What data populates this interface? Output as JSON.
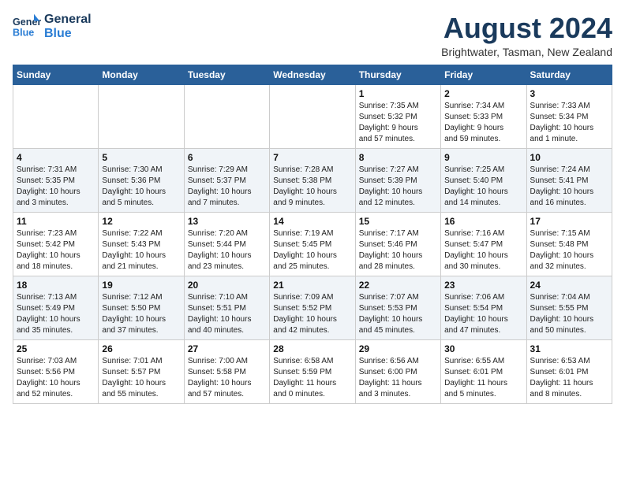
{
  "header": {
    "logo_line1": "General",
    "logo_line2": "Blue",
    "month_year": "August 2024",
    "location": "Brightwater, Tasman, New Zealand"
  },
  "days_of_week": [
    "Sunday",
    "Monday",
    "Tuesday",
    "Wednesday",
    "Thursday",
    "Friday",
    "Saturday"
  ],
  "weeks": [
    [
      {
        "day": "",
        "info": ""
      },
      {
        "day": "",
        "info": ""
      },
      {
        "day": "",
        "info": ""
      },
      {
        "day": "",
        "info": ""
      },
      {
        "day": "1",
        "info": "Sunrise: 7:35 AM\nSunset: 5:32 PM\nDaylight: 9 hours\nand 57 minutes."
      },
      {
        "day": "2",
        "info": "Sunrise: 7:34 AM\nSunset: 5:33 PM\nDaylight: 9 hours\nand 59 minutes."
      },
      {
        "day": "3",
        "info": "Sunrise: 7:33 AM\nSunset: 5:34 PM\nDaylight: 10 hours\nand 1 minute."
      }
    ],
    [
      {
        "day": "4",
        "info": "Sunrise: 7:31 AM\nSunset: 5:35 PM\nDaylight: 10 hours\nand 3 minutes."
      },
      {
        "day": "5",
        "info": "Sunrise: 7:30 AM\nSunset: 5:36 PM\nDaylight: 10 hours\nand 5 minutes."
      },
      {
        "day": "6",
        "info": "Sunrise: 7:29 AM\nSunset: 5:37 PM\nDaylight: 10 hours\nand 7 minutes."
      },
      {
        "day": "7",
        "info": "Sunrise: 7:28 AM\nSunset: 5:38 PM\nDaylight: 10 hours\nand 9 minutes."
      },
      {
        "day": "8",
        "info": "Sunrise: 7:27 AM\nSunset: 5:39 PM\nDaylight: 10 hours\nand 12 minutes."
      },
      {
        "day": "9",
        "info": "Sunrise: 7:25 AM\nSunset: 5:40 PM\nDaylight: 10 hours\nand 14 minutes."
      },
      {
        "day": "10",
        "info": "Sunrise: 7:24 AM\nSunset: 5:41 PM\nDaylight: 10 hours\nand 16 minutes."
      }
    ],
    [
      {
        "day": "11",
        "info": "Sunrise: 7:23 AM\nSunset: 5:42 PM\nDaylight: 10 hours\nand 18 minutes."
      },
      {
        "day": "12",
        "info": "Sunrise: 7:22 AM\nSunset: 5:43 PM\nDaylight: 10 hours\nand 21 minutes."
      },
      {
        "day": "13",
        "info": "Sunrise: 7:20 AM\nSunset: 5:44 PM\nDaylight: 10 hours\nand 23 minutes."
      },
      {
        "day": "14",
        "info": "Sunrise: 7:19 AM\nSunset: 5:45 PM\nDaylight: 10 hours\nand 25 minutes."
      },
      {
        "day": "15",
        "info": "Sunrise: 7:17 AM\nSunset: 5:46 PM\nDaylight: 10 hours\nand 28 minutes."
      },
      {
        "day": "16",
        "info": "Sunrise: 7:16 AM\nSunset: 5:47 PM\nDaylight: 10 hours\nand 30 minutes."
      },
      {
        "day": "17",
        "info": "Sunrise: 7:15 AM\nSunset: 5:48 PM\nDaylight: 10 hours\nand 32 minutes."
      }
    ],
    [
      {
        "day": "18",
        "info": "Sunrise: 7:13 AM\nSunset: 5:49 PM\nDaylight: 10 hours\nand 35 minutes."
      },
      {
        "day": "19",
        "info": "Sunrise: 7:12 AM\nSunset: 5:50 PM\nDaylight: 10 hours\nand 37 minutes."
      },
      {
        "day": "20",
        "info": "Sunrise: 7:10 AM\nSunset: 5:51 PM\nDaylight: 10 hours\nand 40 minutes."
      },
      {
        "day": "21",
        "info": "Sunrise: 7:09 AM\nSunset: 5:52 PM\nDaylight: 10 hours\nand 42 minutes."
      },
      {
        "day": "22",
        "info": "Sunrise: 7:07 AM\nSunset: 5:53 PM\nDaylight: 10 hours\nand 45 minutes."
      },
      {
        "day": "23",
        "info": "Sunrise: 7:06 AM\nSunset: 5:54 PM\nDaylight: 10 hours\nand 47 minutes."
      },
      {
        "day": "24",
        "info": "Sunrise: 7:04 AM\nSunset: 5:55 PM\nDaylight: 10 hours\nand 50 minutes."
      }
    ],
    [
      {
        "day": "25",
        "info": "Sunrise: 7:03 AM\nSunset: 5:56 PM\nDaylight: 10 hours\nand 52 minutes."
      },
      {
        "day": "26",
        "info": "Sunrise: 7:01 AM\nSunset: 5:57 PM\nDaylight: 10 hours\nand 55 minutes."
      },
      {
        "day": "27",
        "info": "Sunrise: 7:00 AM\nSunset: 5:58 PM\nDaylight: 10 hours\nand 57 minutes."
      },
      {
        "day": "28",
        "info": "Sunrise: 6:58 AM\nSunset: 5:59 PM\nDaylight: 11 hours\nand 0 minutes."
      },
      {
        "day": "29",
        "info": "Sunrise: 6:56 AM\nSunset: 6:00 PM\nDaylight: 11 hours\nand 3 minutes."
      },
      {
        "day": "30",
        "info": "Sunrise: 6:55 AM\nSunset: 6:01 PM\nDaylight: 11 hours\nand 5 minutes."
      },
      {
        "day": "31",
        "info": "Sunrise: 6:53 AM\nSunset: 6:01 PM\nDaylight: 11 hours\nand 8 minutes."
      }
    ]
  ]
}
